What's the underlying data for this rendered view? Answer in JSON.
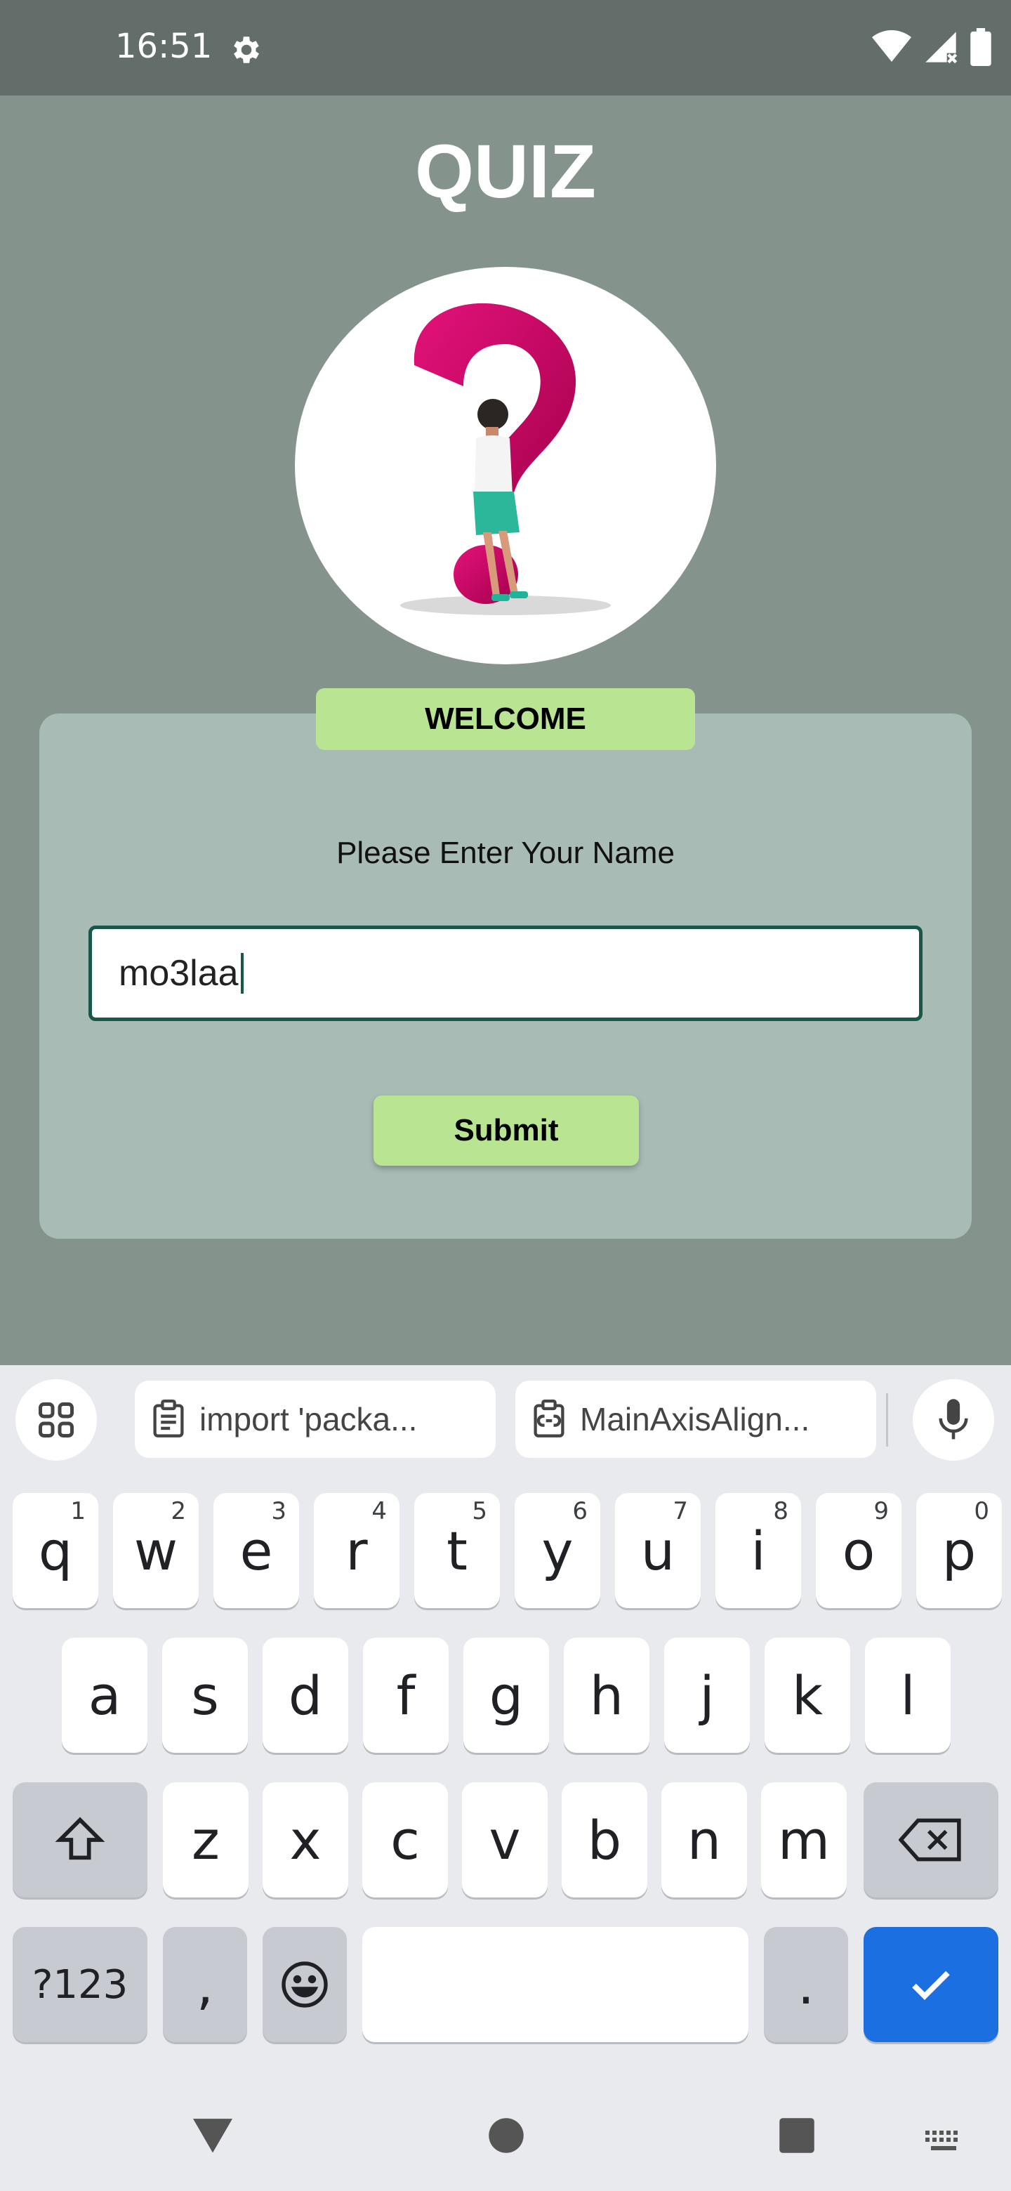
{
  "status_bar": {
    "time": "16:51",
    "icons": [
      "gear-icon",
      "wifi-icon",
      "signal-icon",
      "battery-icon"
    ]
  },
  "app": {
    "title": "QUIZ",
    "welcome_label": "WELCOME",
    "prompt": "Please Enter Your Name",
    "name_input_value": "mo3laa",
    "submit_label": "Submit"
  },
  "keyboard": {
    "suggestions": [
      {
        "icon": "clipboard-icon",
        "text": "import 'packa..."
      },
      {
        "icon": "clipboard-link-icon",
        "text": "MainAxisAlign..."
      }
    ],
    "row1": [
      {
        "key": "q",
        "hint": "1"
      },
      {
        "key": "w",
        "hint": "2"
      },
      {
        "key": "e",
        "hint": "3"
      },
      {
        "key": "r",
        "hint": "4"
      },
      {
        "key": "t",
        "hint": "5"
      },
      {
        "key": "y",
        "hint": "6"
      },
      {
        "key": "u",
        "hint": "7"
      },
      {
        "key": "i",
        "hint": "8"
      },
      {
        "key": "o",
        "hint": "9"
      },
      {
        "key": "p",
        "hint": "0"
      }
    ],
    "row2": [
      "a",
      "s",
      "d",
      "f",
      "g",
      "h",
      "j",
      "k",
      "l"
    ],
    "row3": [
      "z",
      "x",
      "c",
      "v",
      "b",
      "n",
      "m"
    ],
    "symbols_label": "?123",
    "comma": ",",
    "period": "."
  },
  "colors": {
    "status_bar": "#636d69",
    "background": "#84948d",
    "card": "#a9bbb5",
    "accent_green": "#b9e592",
    "input_border": "#19574a",
    "keyboard_done": "#1b6fe0"
  }
}
